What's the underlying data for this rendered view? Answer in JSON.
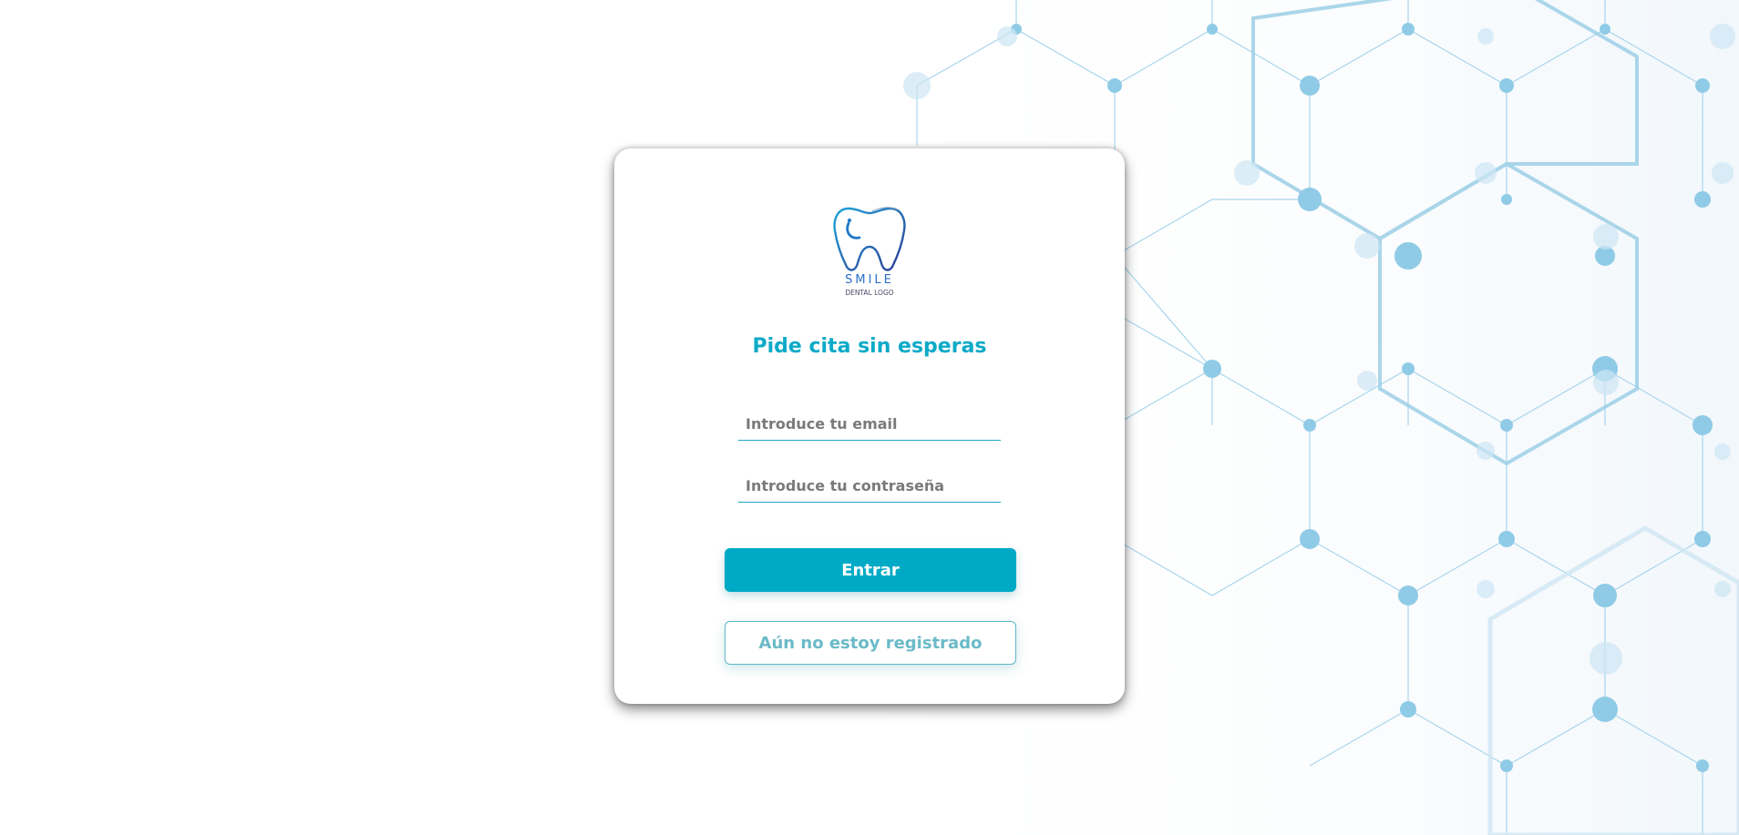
{
  "colors": {
    "accent": "#00aac6",
    "title": "#0eaac8",
    "pattern": "#8fcbe6"
  },
  "logo": {
    "icon": "tooth-smile-icon",
    "word": "SMILE",
    "sub": "DENTAL LOGO"
  },
  "login": {
    "title": "Pide cita sin esperas",
    "email_placeholder": "Introduce tu email",
    "password_placeholder": "Introduce tu contraseña",
    "submit_label": "Entrar",
    "register_label": "Aún no estoy registrado"
  }
}
